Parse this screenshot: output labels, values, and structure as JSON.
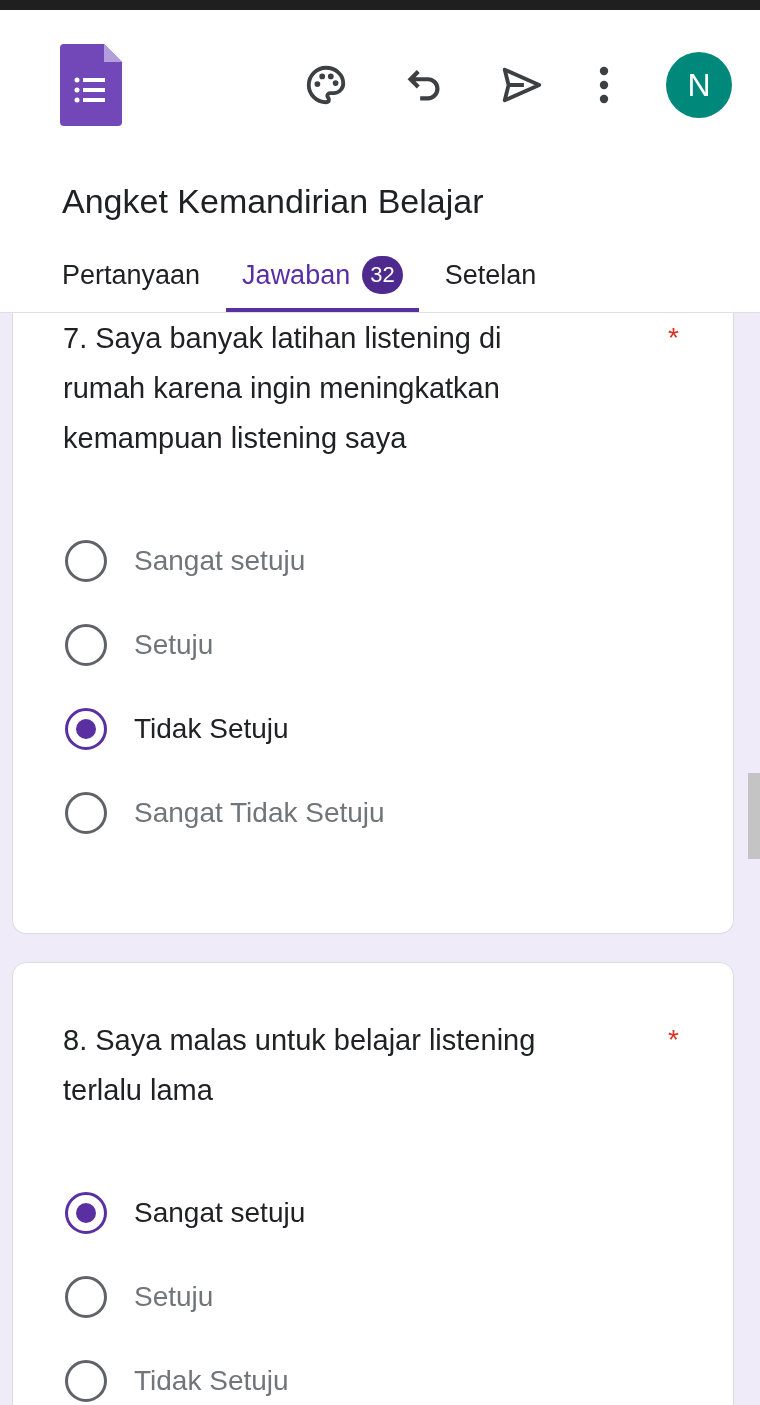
{
  "app": {
    "title": "Angket Kemandirian Belajar",
    "avatar": "N"
  },
  "tabs": [
    {
      "label": "Pertanyaan",
      "selected": false
    },
    {
      "label": "Jawaban",
      "selected": true,
      "badge": "32"
    },
    {
      "label": "Setelan",
      "selected": false
    }
  ],
  "questions": [
    {
      "text": "7. Saya banyak latihan listening di rumah karena ingin meningkatkan kemampuan listening saya",
      "required_mark": "*",
      "top_cut": true,
      "options": [
        {
          "label": "Sangat setuju",
          "selected": false
        },
        {
          "label": "Setuju",
          "selected": false
        },
        {
          "label": "Tidak Setuju",
          "selected": true
        },
        {
          "label": "Sangat Tidak Setuju",
          "selected": false
        }
      ]
    },
    {
      "text": "8. Saya malas untuk belajar listening terlalu lama",
      "required_mark": "*",
      "top_cut": false,
      "options": [
        {
          "label": "Sangat setuju",
          "selected": true
        },
        {
          "label": "Setuju",
          "selected": false
        },
        {
          "label": "Tidak Setuju",
          "selected": false
        }
      ]
    }
  ]
}
